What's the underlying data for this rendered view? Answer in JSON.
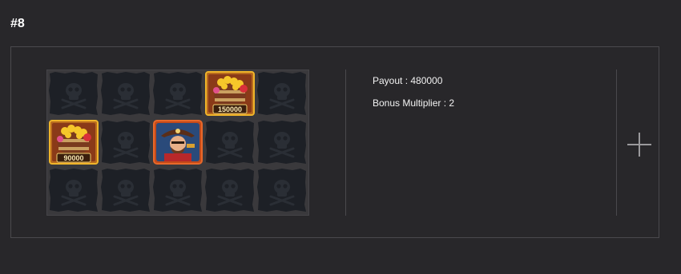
{
  "header": {
    "title": "#8"
  },
  "result": {
    "payout_label": "Payout : 480000",
    "bonus_label": "Bonus Multiplier : 2"
  },
  "reels": {
    "rows": [
      [
        {
          "symbol": "blank-skull-icon",
          "value": ""
        },
        {
          "symbol": "blank-skull-icon",
          "value": ""
        },
        {
          "symbol": "blank-skull-icon",
          "value": ""
        },
        {
          "symbol": "treasure-barrel-icon",
          "value": "150000"
        },
        {
          "symbol": "blank-skull-icon",
          "value": ""
        }
      ],
      [
        {
          "symbol": "treasure-barrel-icon",
          "value": "90000"
        },
        {
          "symbol": "blank-skull-icon",
          "value": ""
        },
        {
          "symbol": "pirate-captain-icon",
          "value": ""
        },
        {
          "symbol": "blank-skull-icon",
          "value": ""
        },
        {
          "symbol": "blank-skull-icon",
          "value": ""
        }
      ],
      [
        {
          "symbol": "blank-skull-icon",
          "value": ""
        },
        {
          "symbol": "blank-skull-icon",
          "value": ""
        },
        {
          "symbol": "blank-skull-icon",
          "value": ""
        },
        {
          "symbol": "blank-skull-icon",
          "value": ""
        },
        {
          "symbol": "blank-skull-icon",
          "value": ""
        }
      ]
    ]
  },
  "controls": {
    "add_icon": "plus-icon"
  },
  "colors": {
    "background": "#28272a",
    "gold_frame": "#f0b52a",
    "tile_dark": "#1d2026",
    "orange_glow": "#e8682a"
  }
}
